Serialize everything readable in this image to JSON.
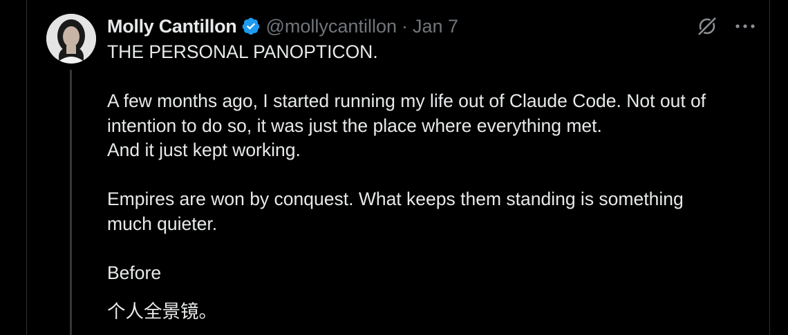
{
  "tweet": {
    "author_name": "Molly Cantillon",
    "handle": "@mollycantillon",
    "separator": "·",
    "date": "Jan 7",
    "title_line": "THE PERSONAL PANOPTICON.",
    "para1_line1": "A few months ago, I started running my life out of Claude Code. Not out of",
    "para1_line2": "intention to do so, it was just the place where everything met.",
    "para1_line3": "And it just kept working.",
    "para2_line1": "Empires are won by conquest. What keeps them standing is something",
    "para2_line2": "much quieter.",
    "para3_line1": "Before",
    "translation": "个人全景镜。"
  },
  "icons": {
    "verified": "verified-badge-icon",
    "grok": "grok-icon",
    "more": "more-options-icon"
  },
  "colors": {
    "background": "#000000",
    "text_primary": "#e7e9ea",
    "text_secondary": "#71767b",
    "verified_blue": "#1d9bf0",
    "thread_line": "#333639"
  }
}
